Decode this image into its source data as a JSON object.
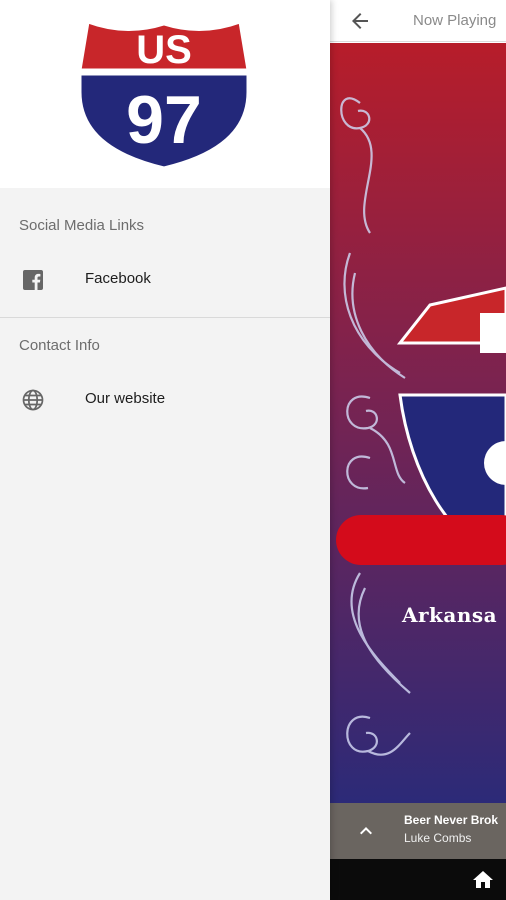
{
  "app_screen": {
    "title": "Now Playing",
    "artwork_caption": "Arkansa",
    "now_playing": {
      "track": "Beer Never Brok",
      "artist": "Luke Combs"
    },
    "icons": {
      "back": "arrow-left-icon",
      "expand": "chevron-up-icon",
      "home": "home-icon"
    }
  },
  "drawer": {
    "logo": {
      "top_text": "US",
      "number": "97"
    },
    "sections": [
      {
        "label": "Social Media Links",
        "items": [
          {
            "label": "Facebook",
            "icon": "facebook-icon"
          }
        ]
      },
      {
        "label": "Contact Info",
        "items": [
          {
            "label": "Our website",
            "icon": "globe-icon"
          }
        ]
      }
    ]
  },
  "colors": {
    "shield_red": "#c8262a",
    "shield_blue": "#23287a",
    "art_red": "#b71d2a",
    "art_purple": "#2c2a78",
    "mini_player_bg": "#6a6560",
    "nav_bg": "#0b0b0b",
    "drawer_bg": "#f3f3f3"
  }
}
